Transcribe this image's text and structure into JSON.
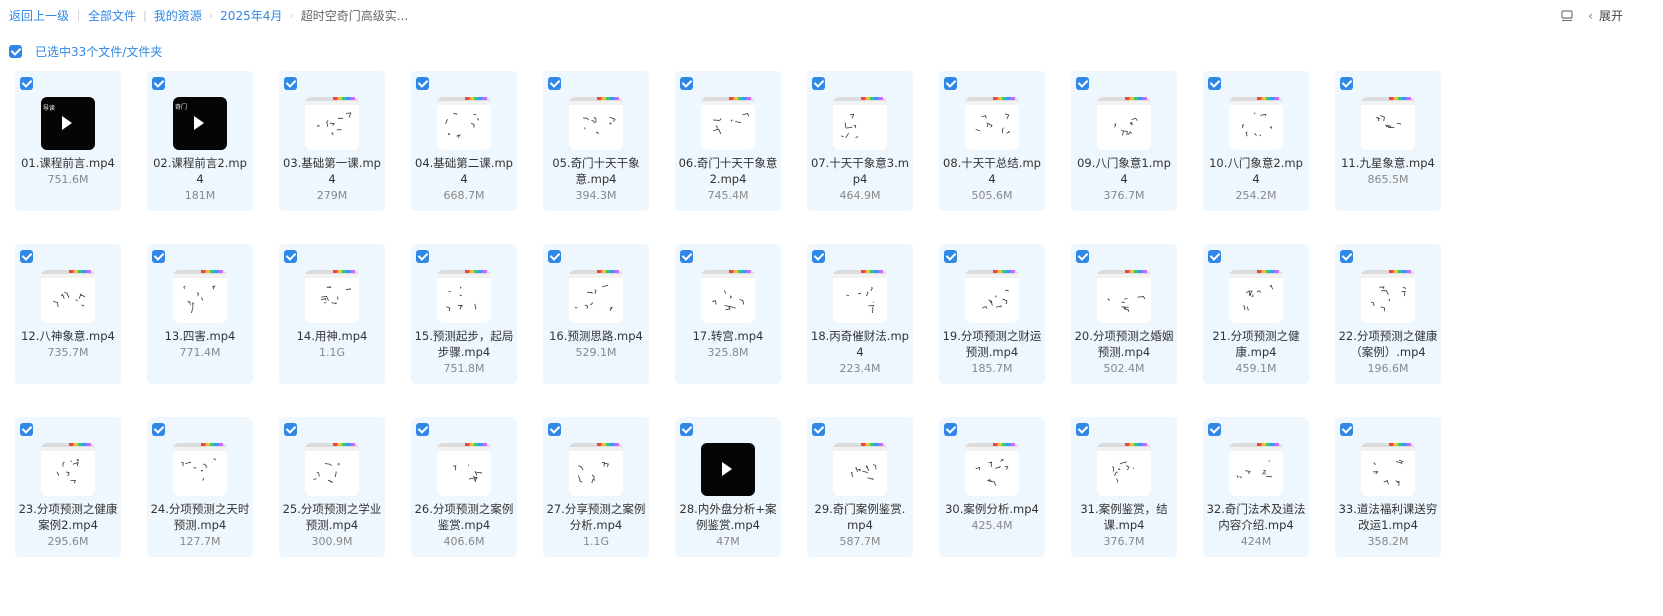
{
  "breadcrumb": {
    "back": "返回上一级",
    "items": [
      "全部文件",
      "我的资源",
      "2025年4月"
    ],
    "current": "超时空奇门高级实..."
  },
  "toolbar": {
    "expand": "展开",
    "list_icon": "list-view-icon",
    "chevron": "‹"
  },
  "selection": {
    "text": "已选中33个文件/文件夹"
  },
  "accent": "#2f87e6",
  "files": [
    {
      "name": "01.课程前言.mp4",
      "size": "751.6M",
      "thumb": "dark",
      "label": "导读"
    },
    {
      "name": "02.课程前言2.mp4",
      "size": "181M",
      "thumb": "dark",
      "label": "奇门"
    },
    {
      "name": "03.基础第一课.mp4",
      "size": "279M",
      "thumb": "white"
    },
    {
      "name": "04.基础第二课.mp4",
      "size": "668.7M",
      "thumb": "white"
    },
    {
      "name": "05.奇门十天干象意.mp4",
      "size": "394.3M",
      "thumb": "white"
    },
    {
      "name": "06.奇门十天干象意2.mp4",
      "size": "745.4M",
      "thumb": "white"
    },
    {
      "name": "07.十天干象意3.mp4",
      "size": "464.9M",
      "thumb": "white"
    },
    {
      "name": "08.十天干总结.mp4",
      "size": "505.6M",
      "thumb": "white"
    },
    {
      "name": "09.八门象意1.mp4",
      "size": "376.7M",
      "thumb": "white"
    },
    {
      "name": "10.八门象意2.mp4",
      "size": "254.2M",
      "thumb": "white"
    },
    {
      "name": "11.九星象意.mp4",
      "size": "865.5M",
      "thumb": "white"
    },
    {
      "name": "12.八神象意.mp4",
      "size": "735.7M",
      "thumb": "white"
    },
    {
      "name": "13.四害.mp4",
      "size": "771.4M",
      "thumb": "white"
    },
    {
      "name": "14.用神.mp4",
      "size": "1.1G",
      "thumb": "white"
    },
    {
      "name": "15.预测起步，起局步骤.mp4",
      "size": "751.8M",
      "thumb": "white"
    },
    {
      "name": "16.预测思路.mp4",
      "size": "529.1M",
      "thumb": "white"
    },
    {
      "name": "17.转宫.mp4",
      "size": "325.8M",
      "thumb": "white"
    },
    {
      "name": "18.丙奇催财法.mp4",
      "size": "223.4M",
      "thumb": "white"
    },
    {
      "name": "19.分项预测之财运预测.mp4",
      "size": "185.7M",
      "thumb": "white"
    },
    {
      "name": "20.分项预测之婚姻预测.mp4",
      "size": "502.4M",
      "thumb": "white"
    },
    {
      "name": "21.分项预测之健康.mp4",
      "size": "459.1M",
      "thumb": "white"
    },
    {
      "name": "22.分项预测之健康（案例）.mp4",
      "size": "196.6M",
      "thumb": "white"
    },
    {
      "name": "23.分项预测之健康案例2.mp4",
      "size": "295.6M",
      "thumb": "white"
    },
    {
      "name": "24.分项预测之天时预测.mp4",
      "size": "127.7M",
      "thumb": "white"
    },
    {
      "name": "25.分项预测之学业预测.mp4",
      "size": "300.9M",
      "thumb": "white"
    },
    {
      "name": "26.分项预测之案例鉴赏.mp4",
      "size": "406.6M",
      "thumb": "white"
    },
    {
      "name": "27.分享预测之案例分析.mp4",
      "size": "1.1G",
      "thumb": "white"
    },
    {
      "name": "28.内外盘分析+案例鉴赏.mp4",
      "size": "47M",
      "thumb": "dark"
    },
    {
      "name": "29.奇门案例鉴赏.mp4",
      "size": "587.7M",
      "thumb": "white"
    },
    {
      "name": "30.案例分析.mp4",
      "size": "425.4M",
      "thumb": "white"
    },
    {
      "name": "31.案例鉴赏，结课.mp4",
      "size": "376.7M",
      "thumb": "white"
    },
    {
      "name": "32.奇门法术及道法内容介绍.mp4",
      "size": "424M",
      "thumb": "white"
    },
    {
      "name": "33.道法福利课送穷改运1.mp4",
      "size": "358.2M",
      "thumb": "white"
    }
  ]
}
